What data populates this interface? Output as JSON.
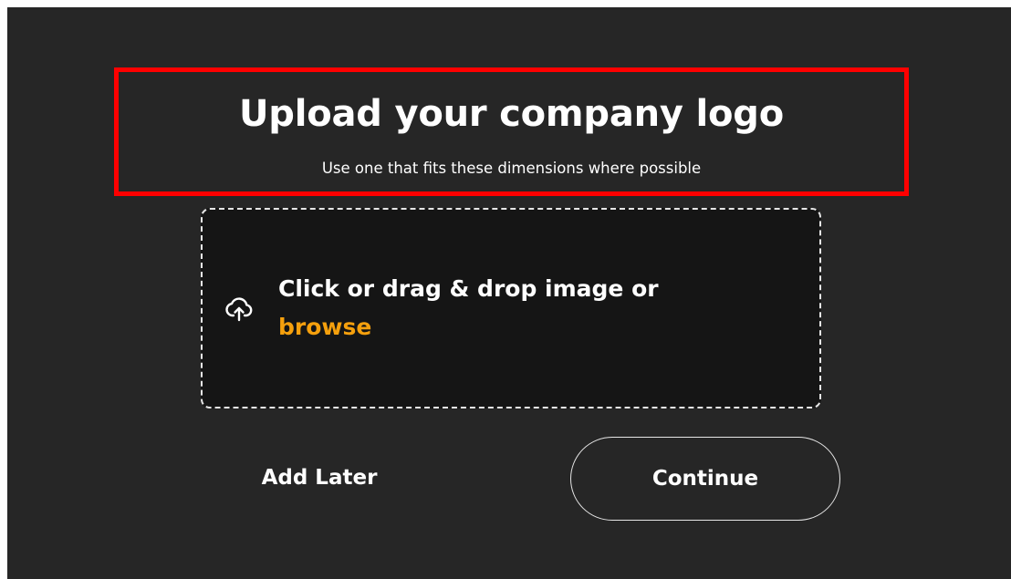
{
  "header": {
    "title": "Upload your company logo",
    "subtitle": "Use one that fits these dimensions where possible"
  },
  "dropzone": {
    "prompt": "Click or drag & drop image or",
    "browse_label": "browse",
    "icon": "cloud-upload-icon"
  },
  "actions": {
    "add_later_label": "Add Later",
    "continue_label": "Continue"
  },
  "colors": {
    "background": "#262626",
    "dropzone_background": "#151515",
    "accent": "#f5a00d",
    "highlight": "#ff0000",
    "text": "#ffffff"
  }
}
